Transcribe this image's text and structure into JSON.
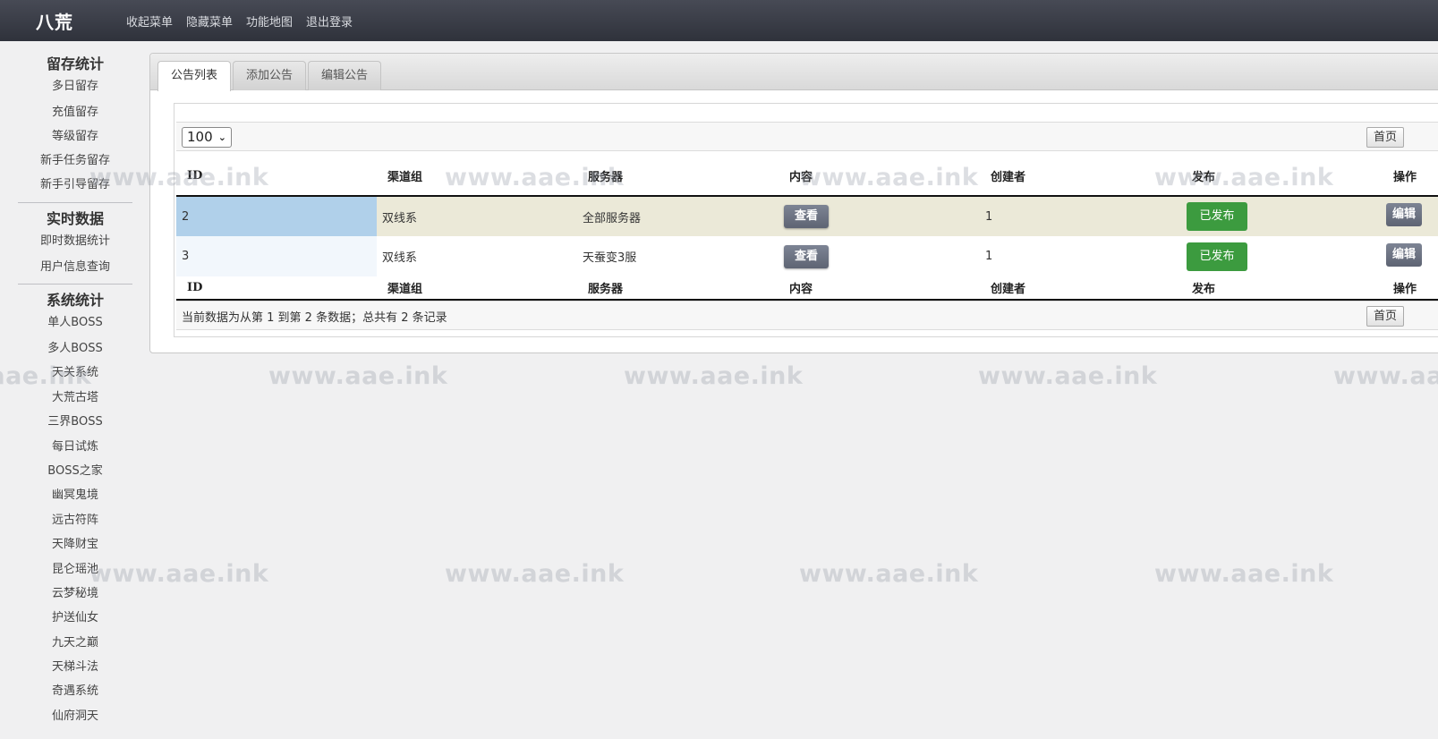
{
  "app": {
    "brand": "八荒",
    "top_nav": [
      "收起菜单",
      "隐藏菜单",
      "功能地图",
      "退出登录"
    ]
  },
  "sidebar": {
    "groups": [
      {
        "title": "留存统计",
        "items": [
          "多日留存",
          "充值留存",
          "等级留存",
          "新手任务留存",
          "新手引导留存"
        ]
      },
      {
        "title": "实时数据",
        "items": [
          "即时数据统计",
          "用户信息查询"
        ]
      },
      {
        "title": "系统统计",
        "items": [
          "单人BOSS",
          "多人BOSS",
          "天关系统",
          "大荒古塔",
          "三界BOSS",
          "每日试炼",
          "BOSS之家",
          "幽冥鬼境",
          "远古符阵",
          "天降财宝",
          "昆仑瑶池",
          "云梦秘境",
          "护送仙女",
          "九天之巅",
          "天梯斗法",
          "奇遇系统",
          "仙府洞天"
        ]
      }
    ]
  },
  "tabs": [
    {
      "label": "公告列表",
      "active": true
    },
    {
      "label": "添加公告",
      "active": false
    },
    {
      "label": "编辑公告",
      "active": false
    }
  ],
  "table": {
    "page_size": "100",
    "first_page_label": "首页",
    "columns": [
      "ID",
      "渠道组",
      "服务器",
      "内容",
      "创建者",
      "发布",
      "操作"
    ],
    "rows": [
      {
        "id": "2",
        "channel": "双线系",
        "server": "全部服务器",
        "content_btn": "查看",
        "creator": "1",
        "publish_btn": "已发布",
        "action_btn": "编辑"
      },
      {
        "id": "3",
        "channel": "双线系",
        "server": "天蚕变3服",
        "content_btn": "查看",
        "creator": "1",
        "publish_btn": "已发布",
        "action_btn": "编辑"
      }
    ],
    "info_text": "当前数据为从第 1 到第 2 条数据；总共有 2 条记录"
  },
  "watermark": "www.aae.ink",
  "colors": {
    "topbar": "#3a3d47",
    "publish_green": "#3c9b3f",
    "view_button": "#6b7180",
    "row_highlight": "#ebe9d8",
    "sorted_cell": "#b0d0ea"
  }
}
